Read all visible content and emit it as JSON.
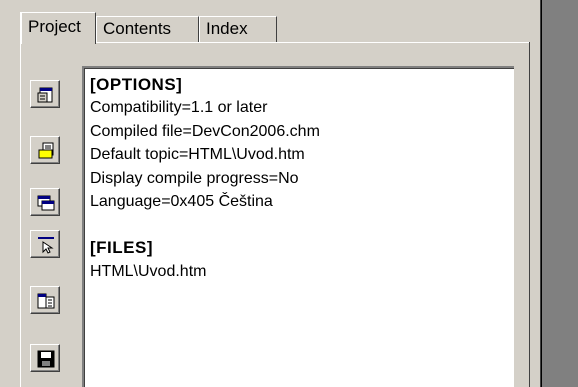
{
  "tabs": [
    {
      "label": "Project",
      "selected": true
    },
    {
      "label": "Contents",
      "selected": false
    },
    {
      "label": "Index",
      "selected": false
    }
  ],
  "toolbar": [
    {
      "icon": "change-project-options-icon"
    },
    {
      "icon": "add-remove-topic-files-icon"
    },
    {
      "icon": "add-modify-window-definitions-icon"
    },
    {
      "icon": "html-api-information-icon"
    },
    {
      "icon": "view-html-source-icon"
    },
    {
      "icon": "save-project-compile-icon"
    }
  ],
  "editor": {
    "options_header": "[OPTIONS]",
    "options": [
      "Compatibility=1.1 or later",
      "Compiled file=DevCon2006.chm",
      "Default topic=HTML\\Uvod.htm",
      "Display compile progress=No",
      "Language=0x405 Čeština"
    ],
    "files_header": "[FILES]",
    "files": [
      "HTML\\Uvod.htm"
    ]
  }
}
